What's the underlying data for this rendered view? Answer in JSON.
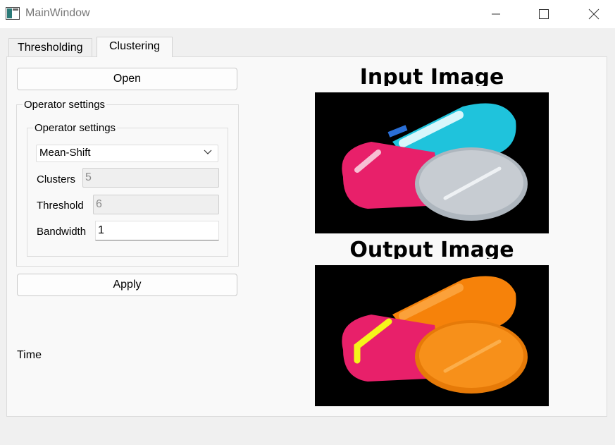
{
  "window": {
    "title": "MainWindow"
  },
  "tabs": [
    {
      "label": "Thresholding",
      "active": false
    },
    {
      "label": "Clustering",
      "active": true
    }
  ],
  "controls": {
    "open_label": "Open",
    "apply_label": "Apply",
    "time_label": "Time"
  },
  "outer_group": {
    "title": "Operator settings"
  },
  "inner_group": {
    "title": "Operator settings",
    "operator_select": "Mean-Shift",
    "clusters_label": "Clusters",
    "clusters_value": "5",
    "threshold_label": "Threshold",
    "threshold_value": "6",
    "bandwidth_label": "Bandwidth",
    "bandwidth_value": "1"
  },
  "images": {
    "input_title": "Input Image",
    "output_title": "Output Image"
  },
  "colors": {
    "input_capsule_pink": "#e8206a",
    "input_capsule_cyan": "#1fc3dc",
    "input_tablet_gray": "#c7ccd2",
    "output_orange": "#f6820a",
    "output_pink": "#e8206a",
    "output_yellow": "#f5f51a"
  }
}
